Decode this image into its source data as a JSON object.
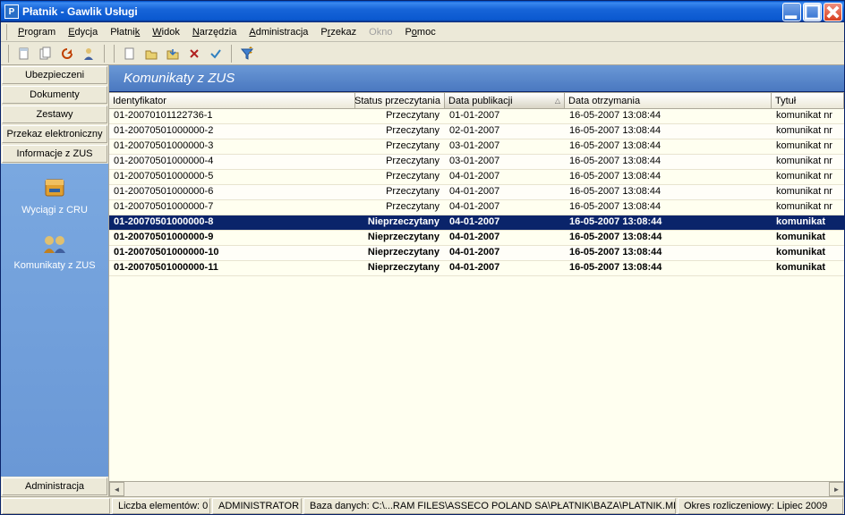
{
  "title": "Płatnik - Gawlik Usługi",
  "menu": {
    "program": "Program",
    "edycja": "Edycja",
    "platnik": "Płatnik",
    "widok": "Widok",
    "narzedzia": "Narzędzia",
    "administracja": "Administracja",
    "przekaz": "Przekaz",
    "okno": "Okno",
    "pomoc": "Pomoc"
  },
  "sidebar": {
    "ubezpieczeni": "Ubezpieczeni",
    "dokumenty": "Dokumenty",
    "zestawy": "Zestawy",
    "przekaz": "Przekaz elektroniczny",
    "informacje": "Informacje z ZUS",
    "wyciagi": "Wyciągi z CRU",
    "komunikaty": "Komunikaty z ZUS",
    "administracja": "Administracja"
  },
  "pane_title": "Komunikaty z ZUS",
  "columns": {
    "id": "Identyfikator",
    "status": "Status przeczytania",
    "pub": "Data publikacji",
    "recv": "Data otrzymania",
    "title": "Tytuł"
  },
  "rows": [
    {
      "id": "01-20070101122736-1",
      "status": "Przeczytany",
      "pub": "01-01-2007",
      "recv": "16-05-2007 13:08:44",
      "title": "komunikat nr",
      "bold": false,
      "selected": false
    },
    {
      "id": "01-20070501000000-2",
      "status": "Przeczytany",
      "pub": "02-01-2007",
      "recv": "16-05-2007 13:08:44",
      "title": "komunikat nr",
      "bold": false,
      "selected": false
    },
    {
      "id": "01-20070501000000-3",
      "status": "Przeczytany",
      "pub": "03-01-2007",
      "recv": "16-05-2007 13:08:44",
      "title": "komunikat nr",
      "bold": false,
      "selected": false
    },
    {
      "id": "01-20070501000000-4",
      "status": "Przeczytany",
      "pub": "03-01-2007",
      "recv": "16-05-2007 13:08:44",
      "title": "komunikat nr",
      "bold": false,
      "selected": false
    },
    {
      "id": "01-20070501000000-5",
      "status": "Przeczytany",
      "pub": "04-01-2007",
      "recv": "16-05-2007 13:08:44",
      "title": "komunikat nr",
      "bold": false,
      "selected": false
    },
    {
      "id": "01-20070501000000-6",
      "status": "Przeczytany",
      "pub": "04-01-2007",
      "recv": "16-05-2007 13:08:44",
      "title": "komunikat nr",
      "bold": false,
      "selected": false
    },
    {
      "id": "01-20070501000000-7",
      "status": "Przeczytany",
      "pub": "04-01-2007",
      "recv": "16-05-2007 13:08:44",
      "title": "komunikat nr",
      "bold": false,
      "selected": false
    },
    {
      "id": "01-20070501000000-8",
      "status": "Nieprzeczytany",
      "pub": "04-01-2007",
      "recv": "16-05-2007 13:08:44",
      "title": "komunikat",
      "bold": true,
      "selected": true
    },
    {
      "id": "01-20070501000000-9",
      "status": "Nieprzeczytany",
      "pub": "04-01-2007",
      "recv": "16-05-2007 13:08:44",
      "title": "komunikat",
      "bold": true,
      "selected": false
    },
    {
      "id": "01-20070501000000-10",
      "status": "Nieprzeczytany",
      "pub": "04-01-2007",
      "recv": "16-05-2007 13:08:44",
      "title": "komunikat",
      "bold": true,
      "selected": false
    },
    {
      "id": "01-20070501000000-11",
      "status": "Nieprzeczytany",
      "pub": "04-01-2007",
      "recv": "16-05-2007 13:08:44",
      "title": "komunikat",
      "bold": true,
      "selected": false
    }
  ],
  "status": {
    "count": "Liczba elementów: 0",
    "user": "ADMINISTRATOR",
    "db": "Baza danych: C:\\...RAM FILES\\ASSECO POLAND SA\\PŁATNIK\\BAZA\\PLATNIK.MDB",
    "period": "Okres rozliczeniowy: Lipiec 2009"
  }
}
